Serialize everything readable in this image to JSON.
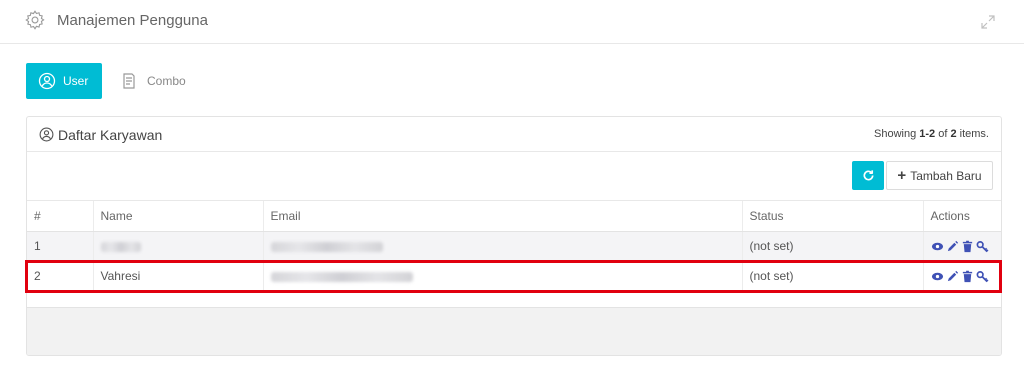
{
  "header": {
    "title": "Manajemen Pengguna",
    "settings_icon": "gear-icon",
    "expand_icon": "expand-icon"
  },
  "tabs": [
    {
      "label": "User",
      "icon": "user-circle-icon",
      "active": true
    },
    {
      "label": "Combo",
      "icon": "document-icon",
      "active": false
    }
  ],
  "card": {
    "title": "Daftar Karyawan",
    "summary_prefix": "Showing ",
    "summary_range": "1-2",
    "summary_of": " of ",
    "summary_total": "2",
    "summary_suffix": " items."
  },
  "toolbar": {
    "add_label": "Tambah Baru",
    "refresh_icon": "refresh-icon"
  },
  "table": {
    "columns": [
      "#",
      "Name",
      "Email",
      "Status",
      "Actions"
    ],
    "rows": [
      {
        "num": "1",
        "name": "",
        "email": "",
        "status": "(not set)"
      },
      {
        "num": "2",
        "name": "Vahresi",
        "email": "",
        "status": "(not set)"
      }
    ]
  },
  "colors": {
    "accent": "#00bcd4",
    "action_icons": "#3f51b5",
    "highlight": "#e1000f"
  }
}
